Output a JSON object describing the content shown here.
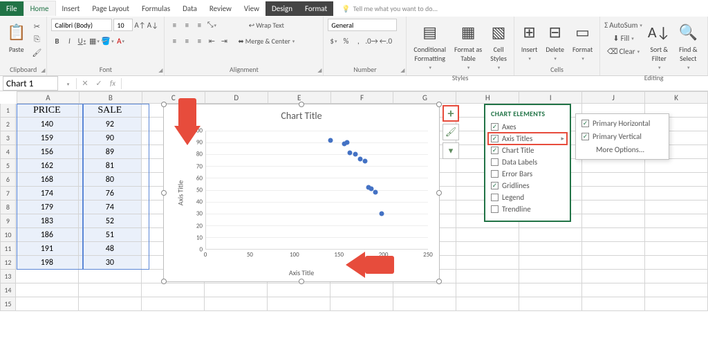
{
  "tabs": {
    "file": "File",
    "home": "Home",
    "insert": "Insert",
    "pagelayout": "Page Layout",
    "formulas": "Formulas",
    "data": "Data",
    "review": "Review",
    "view": "View",
    "design": "Design",
    "format": "Format",
    "tellme": "Tell me what you want to do..."
  },
  "ribbon": {
    "clipboard": {
      "label": "Clipboard",
      "paste": "Paste"
    },
    "font": {
      "label": "Font",
      "name": "Calibri (Body)",
      "size": "10",
      "b": "B",
      "i": "I",
      "u": "U"
    },
    "alignment": {
      "label": "Alignment",
      "wrap": "Wrap Text",
      "merge": "Merge & Center"
    },
    "number": {
      "label": "Number",
      "format": "General"
    },
    "styles": {
      "label": "Styles",
      "cond": "Conditional\nFormatting",
      "fat": "Format as\nTable",
      "cstyles": "Cell\nStyles"
    },
    "cells": {
      "label": "Cells",
      "insert": "Insert",
      "delete": "Delete",
      "format": "Format"
    },
    "editing": {
      "label": "Editing",
      "autosum": "AutoSum",
      "fill": "Fill",
      "clear": "Clear",
      "sort": "Sort &\nFilter",
      "find": "Find &\nSelect"
    }
  },
  "namebox": "Chart 1",
  "fx": "fx",
  "columns": [
    "A",
    "B",
    "C",
    "D",
    "E",
    "F",
    "G",
    "H",
    "I",
    "J",
    "K"
  ],
  "headers": {
    "a": "PRICE",
    "b": "SALE"
  },
  "rows": [
    {
      "n": 1,
      "a": "PRICE",
      "b": "SALE"
    },
    {
      "n": 2,
      "a": "140",
      "b": "92"
    },
    {
      "n": 3,
      "a": "159",
      "b": "90"
    },
    {
      "n": 4,
      "a": "156",
      "b": "89"
    },
    {
      "n": 5,
      "a": "162",
      "b": "81"
    },
    {
      "n": 6,
      "a": "168",
      "b": "80"
    },
    {
      "n": 7,
      "a": "174",
      "b": "76"
    },
    {
      "n": 8,
      "a": "179",
      "b": "74"
    },
    {
      "n": 9,
      "a": "183",
      "b": "52"
    },
    {
      "n": 10,
      "a": "186",
      "b": "51"
    },
    {
      "n": 11,
      "a": "191",
      "b": "48"
    },
    {
      "n": 12,
      "a": "198",
      "b": "30"
    }
  ],
  "empty_rows": [
    13,
    14,
    15
  ],
  "chart": {
    "title": "Chart Title",
    "yaxis_title": "Axis Title",
    "xaxis_title": "Axis Title",
    "yticks": [
      "0",
      "10",
      "20",
      "30",
      "40",
      "50",
      "60",
      "70",
      "80",
      "90",
      "100"
    ],
    "xticks": [
      "0",
      "50",
      "100",
      "150",
      "200",
      "250"
    ]
  },
  "chart_data": {
    "type": "scatter",
    "title": "Chart Title",
    "xlabel": "Axis Title",
    "ylabel": "Axis Title",
    "xlim": [
      0,
      250
    ],
    "ylim": [
      0,
      100
    ],
    "x": [
      140,
      159,
      156,
      162,
      168,
      174,
      179,
      183,
      186,
      191,
      198
    ],
    "y": [
      92,
      90,
      89,
      81,
      80,
      76,
      74,
      52,
      51,
      48,
      30
    ]
  },
  "chartbtns": {
    "plus": "+",
    "brush": "🖌",
    "funnel": "⯑"
  },
  "popup": {
    "title": "CHART ELEMENTS",
    "items": [
      {
        "label": "Axes",
        "checked": true
      },
      {
        "label": "Axis Titles",
        "checked": true,
        "hi": true
      },
      {
        "label": "Chart Title",
        "checked": true
      },
      {
        "label": "Data Labels",
        "checked": false
      },
      {
        "label": "Error Bars",
        "checked": false
      },
      {
        "label": "Gridlines",
        "checked": true
      },
      {
        "label": "Legend",
        "checked": false
      },
      {
        "label": "Trendline",
        "checked": false
      }
    ]
  },
  "submenu": {
    "items": [
      {
        "label": "Primary Horizontal",
        "checked": true
      },
      {
        "label": "Primary Vertical",
        "checked": true
      },
      {
        "label": "More Options...",
        "checked": null
      }
    ]
  }
}
